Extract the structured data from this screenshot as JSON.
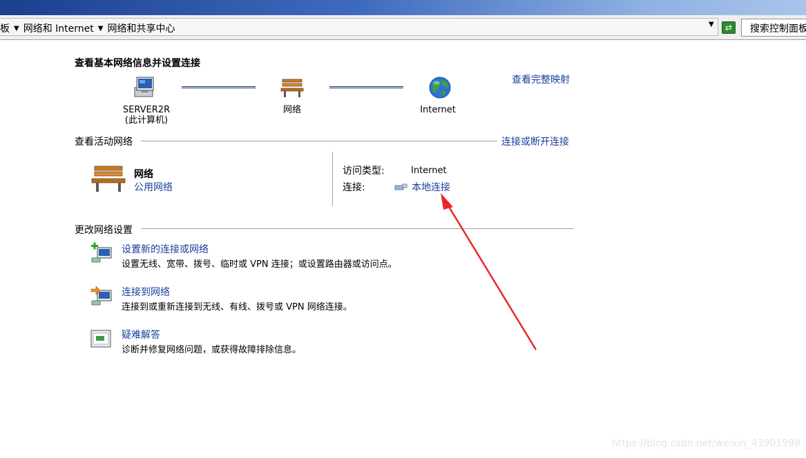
{
  "breadcrumb": {
    "items": [
      "板",
      "网络和 Internet",
      "网络和共享中心"
    ]
  },
  "search": {
    "placeholder": "搜索控制面板"
  },
  "main": {
    "title": "查看基本网络信息并设置连接",
    "view_full_map": "查看完整映射",
    "network_map": {
      "computer_name": "SERVER2R",
      "computer_sub": "(此计算机)",
      "network_label": "网络",
      "internet_label": "Internet"
    },
    "active_networks": {
      "section_title": "查看活动网络",
      "connect_disconnect": "连接或断开连接",
      "network_name": "网络",
      "network_type": "公用网络",
      "access_type_label": "访问类型:",
      "access_type_value": "Internet",
      "connection_label": "连接:",
      "connection_value": "本地连接"
    },
    "change_settings": {
      "section_title": "更改网络设置",
      "tasks": [
        {
          "title": "设置新的连接或网络",
          "desc": "设置无线、宽带、拨号、临时或 VPN 连接；或设置路由器或访问点。",
          "icon": "new-connection-icon"
        },
        {
          "title": "连接到网络",
          "desc": "连接到或重新连接到无线、有线、拨号或 VPN 网络连接。",
          "icon": "connect-network-icon"
        },
        {
          "title": "疑难解答",
          "desc": "诊断并修复网络问题，或获得故障排除信息。",
          "icon": "troubleshoot-icon"
        }
      ]
    }
  },
  "annotation": {
    "color": "#e8262a"
  },
  "watermark": "https://blog.csdn.net/weixin_43901998"
}
